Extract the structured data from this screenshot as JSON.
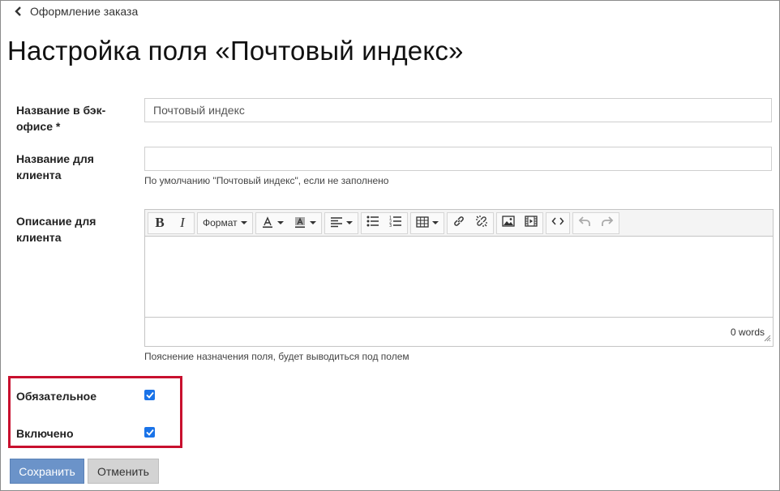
{
  "breadcrumb": {
    "back_label": "Оформление заказа"
  },
  "page": {
    "title": "Настройка поля «Почтовый индекс»"
  },
  "form": {
    "backoffice_name": {
      "label": "Название в бэк-офисе *",
      "value": "Почтовый индекс"
    },
    "client_name": {
      "label": "Название для клиента",
      "value": "",
      "hint": "По умолчанию \"Почтовый индекс\", если не заполнено"
    },
    "client_description": {
      "label": "Описание для клиента",
      "hint": "Пояснение назначения поля, будет выводиться под полем",
      "editor": {
        "toolbar": {
          "bold": "B",
          "italic": "I",
          "format_label": "Формат"
        },
        "word_count": "0 words"
      }
    },
    "required": {
      "label": "Обязательное",
      "checked": true
    },
    "enabled": {
      "label": "Включено",
      "checked": true
    }
  },
  "actions": {
    "save_label": "Сохранить",
    "cancel_label": "Отменить"
  },
  "colors": {
    "accent": "#1a73e8",
    "save_button": "#6b93c9",
    "highlight": "#c8102e"
  }
}
